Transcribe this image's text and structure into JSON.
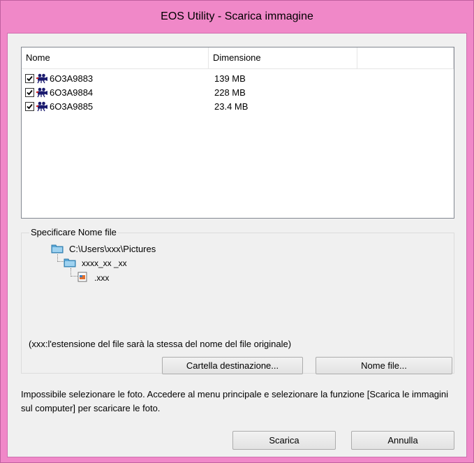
{
  "window": {
    "title": "EOS Utility - Scarica immagine"
  },
  "list": {
    "columns": [
      "Nome",
      "Dimensione"
    ],
    "rows": [
      {
        "name": "6O3A9883",
        "size": "139 MB",
        "checked": true,
        "icon": "movie-camera-icon"
      },
      {
        "name": "6O3A9884",
        "size": "228 MB",
        "checked": true,
        "icon": "movie-camera-icon"
      },
      {
        "name": "6O3A9885",
        "size": "23.4 MB",
        "checked": true,
        "icon": "movie-camera-icon"
      }
    ]
  },
  "filename_group": {
    "legend": "Specificare Nome file",
    "path_root": "C:\\Users\\xxx\\Pictures",
    "subfolder": "xxxx_xx _xx",
    "file": ".xxx",
    "note": "(xxx:l'estensione del file sarà la stessa del nome del file originale)",
    "dest_button": "Cartella destinazione...",
    "name_button": "Nome file..."
  },
  "message": "Impossibile selezionare le foto. Accedere al menu principale e selezionare la funzione [Scarica le immagini sul computer] per scaricare le foto.",
  "buttons": {
    "download": "Scarica",
    "cancel": "Annulla"
  },
  "colors": {
    "frame": "#f088c8",
    "client": "#f0f0f0",
    "folder": "#5aa8d8"
  }
}
